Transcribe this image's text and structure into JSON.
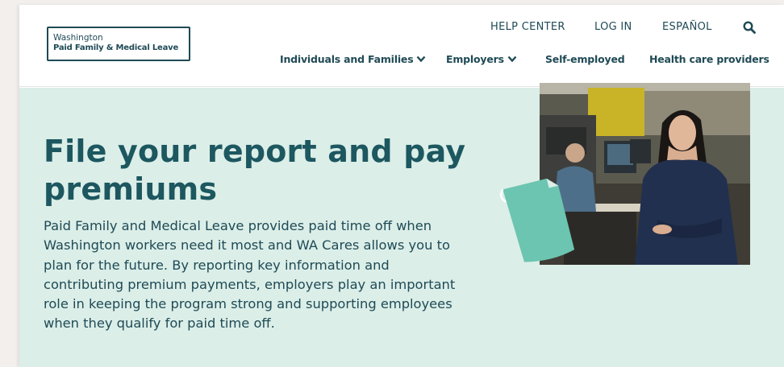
{
  "header": {
    "logo": {
      "line1": "Washington",
      "line2": "Paid Family & Medical Leave"
    },
    "utility_nav": {
      "help_center": "HELP CENTER",
      "log_in": "LOG IN",
      "espanol": "ESPAÑOL"
    },
    "main_nav": {
      "individuals": "Individuals and Families",
      "employers": "Employers",
      "self_employed": "Self-employed",
      "health_care": "Health care providers"
    }
  },
  "hero": {
    "headline_line1": "File your report and pay",
    "headline_line2": "premiums",
    "body": "Paid Family and Medical Leave provides paid time off when Washington workers need it most and WA Cares allows you to plan for the future. By reporting key information and contributing premium payments, employers play an important role in keeping the program strong and supporting employees when they qualify for paid time off."
  },
  "colors": {
    "brand_dark": "#1f4a55",
    "headline": "#1d5760",
    "hero_bg": "#dbeee8",
    "accent_teal": "#6cc5b0"
  },
  "icons": {
    "search": "search-icon",
    "chevron": "chevron-down-icon",
    "document": "document-icon"
  }
}
